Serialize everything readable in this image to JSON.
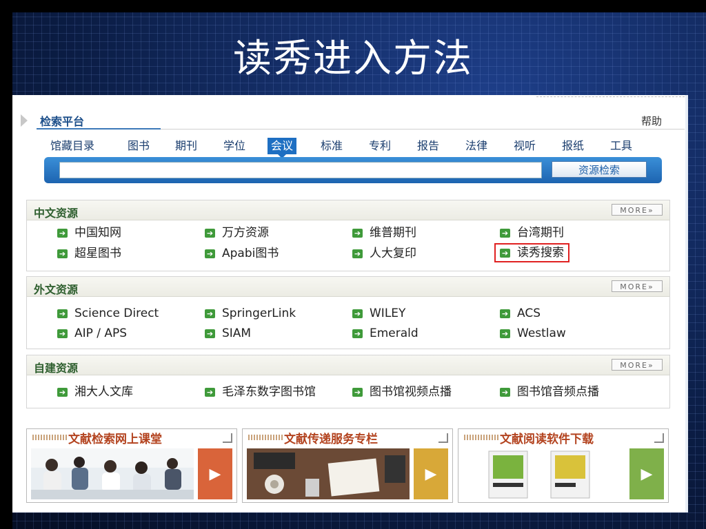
{
  "slide": {
    "title": "读秀进入方法"
  },
  "search": {
    "header_title": "检索平台",
    "help": "帮助",
    "tabs": [
      "馆藏目录",
      "图书",
      "期刊",
      "学位",
      "会议",
      "标准",
      "专利",
      "报告",
      "法律",
      "视听",
      "报纸",
      "工具"
    ],
    "active_tab": "会议",
    "input_value": "",
    "button_label": "资源检索"
  },
  "sections": [
    {
      "title": "中文资源",
      "more": "MORE»",
      "items": [
        "中国知网",
        "万方资源",
        "维普期刊",
        "台湾期刊",
        "超星图书",
        "Apabi图书",
        "人大复印",
        "读秀搜索"
      ],
      "highlighted": "读秀搜索"
    },
    {
      "title": "外文资源",
      "more": "MORE»",
      "items": [
        "Science Direct",
        "SpringerLink",
        "WILEY",
        "ACS",
        "AIP / APS",
        "SIAM",
        "Emerald",
        "Westlaw"
      ]
    },
    {
      "title": "自建资源",
      "more": "MORE»",
      "items": [
        "湘大人文库",
        "毛泽东数字图书馆",
        "图书馆视频点播",
        "图书馆音频点播"
      ]
    }
  ],
  "promos": [
    {
      "title": "文献检索网上课堂",
      "go_color": "#d9643a"
    },
    {
      "title": "文献传递服务专栏",
      "go_color": "#d8a838"
    },
    {
      "title": "文献阅读软件下载",
      "go_color": "#7fb04a"
    }
  ],
  "colors": {
    "accent": "#1e6fc2",
    "bullet": "#3f9a3a",
    "highlight_border": "#e02020"
  }
}
